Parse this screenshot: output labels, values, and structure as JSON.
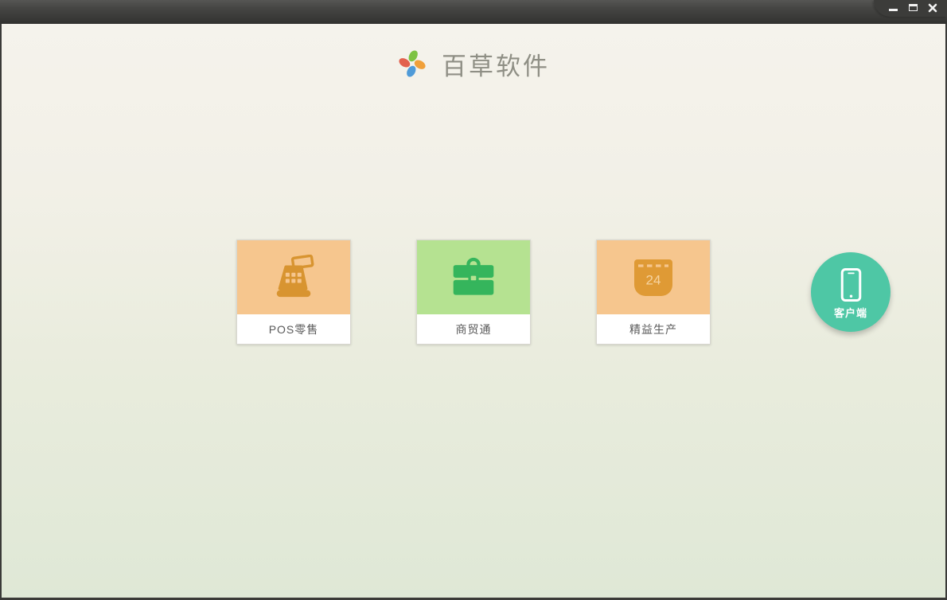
{
  "app": {
    "title": "百草软件",
    "logo_icon": "pinwheel-logo-icon",
    "logo_colors": {
      "top": "#7dc242",
      "right": "#f0a03a",
      "bottom": "#4f9bd8",
      "left": "#e2614e"
    }
  },
  "titlebar": {
    "controls": [
      {
        "name": "minimize",
        "icon": "minimize-icon"
      },
      {
        "name": "maximize",
        "icon": "maximize-icon"
      },
      {
        "name": "close",
        "icon": "close-icon"
      }
    ]
  },
  "products": [
    {
      "label": "POS零售",
      "icon": "cash-register-icon",
      "tile_color": "#f6c68e",
      "icon_color": "#d89430"
    },
    {
      "label": "商贸通",
      "icon": "briefcase-icon",
      "tile_color": "#b5e291",
      "icon_color": "#35b55c"
    },
    {
      "label": "精益生产",
      "icon": "calendar-icon",
      "tile_color": "#f6c68e",
      "icon_color": "#df9a35",
      "calendar_day": "24"
    }
  ],
  "client_button": {
    "label": "客户端",
    "icon": "smartphone-icon",
    "color": "#4ec7a5"
  }
}
